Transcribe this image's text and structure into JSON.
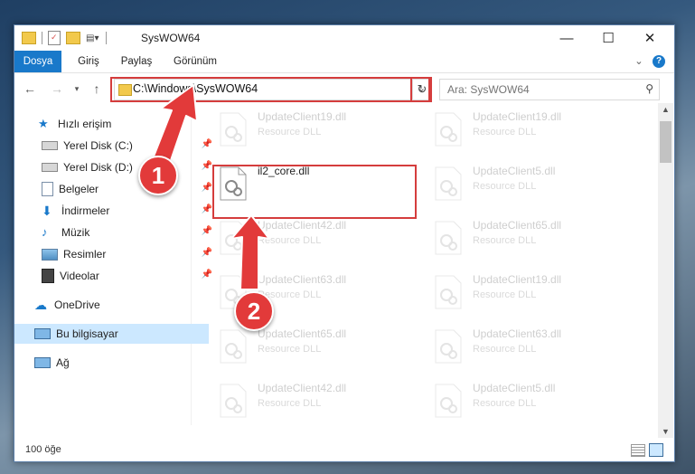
{
  "window": {
    "title": "SysWOW64",
    "controls": {
      "minimize": "—",
      "maximize": "☐",
      "close": "✕"
    }
  },
  "ribbon": {
    "tabs": [
      "Dosya",
      "Giriş",
      "Paylaş",
      "Görünüm"
    ],
    "collapse": "⌄",
    "help": "?"
  },
  "address_bar": {
    "path": "C:\\Windows\\SysWOW64",
    "search_placeholder": "Ara: SysWOW64"
  },
  "sidebar": {
    "items": [
      {
        "label": "Hızlı erişim",
        "icon": "star-icon"
      },
      {
        "label": "Yerel Disk (C:)",
        "icon": "drive-icon"
      },
      {
        "label": "Yerel Disk (D:)",
        "icon": "drive-icon"
      },
      {
        "label": "Belgeler",
        "icon": "document-icon"
      },
      {
        "label": "İndirmeler",
        "icon": "download-icon"
      },
      {
        "label": "Müzik",
        "icon": "music-icon"
      },
      {
        "label": "Resimler",
        "icon": "pictures-icon"
      },
      {
        "label": "Videolar",
        "icon": "video-icon"
      },
      {
        "label": "OneDrive",
        "icon": "cloud-icon"
      },
      {
        "label": "Bu bilgisayar",
        "icon": "computer-icon"
      },
      {
        "label": "Ağ",
        "icon": "network-icon"
      }
    ]
  },
  "files": {
    "left": [
      {
        "name": "UpdateClient19.dll",
        "type": "Resource DLL"
      },
      {
        "name": "il2_core.dll",
        "type": ""
      },
      {
        "name": "UpdateClient42.dll",
        "type": "Resource DLL"
      },
      {
        "name": "UpdateClient63.dll",
        "type": "Resource DLL"
      },
      {
        "name": "UpdateClient65.dll",
        "type": "Resource DLL"
      },
      {
        "name": "UpdateClient42.dll",
        "type": "Resource DLL"
      }
    ],
    "right": [
      {
        "name": "UpdateClient19.dll",
        "type": "Resource DLL"
      },
      {
        "name": "UpdateClient5.dll",
        "type": "Resource DLL"
      },
      {
        "name": "UpdateClient65.dll",
        "type": "Resource DLL"
      },
      {
        "name": "UpdateClient19.dll",
        "type": "Resource DLL"
      },
      {
        "name": "UpdateClient63.dll",
        "type": "Resource DLL"
      },
      {
        "name": "UpdateClient5.dll",
        "type": "Resource DLL"
      }
    ]
  },
  "status": {
    "item_count": "100 öğe"
  },
  "annotations": {
    "step1": "1",
    "step2": "2",
    "color": "#e23a3a"
  }
}
